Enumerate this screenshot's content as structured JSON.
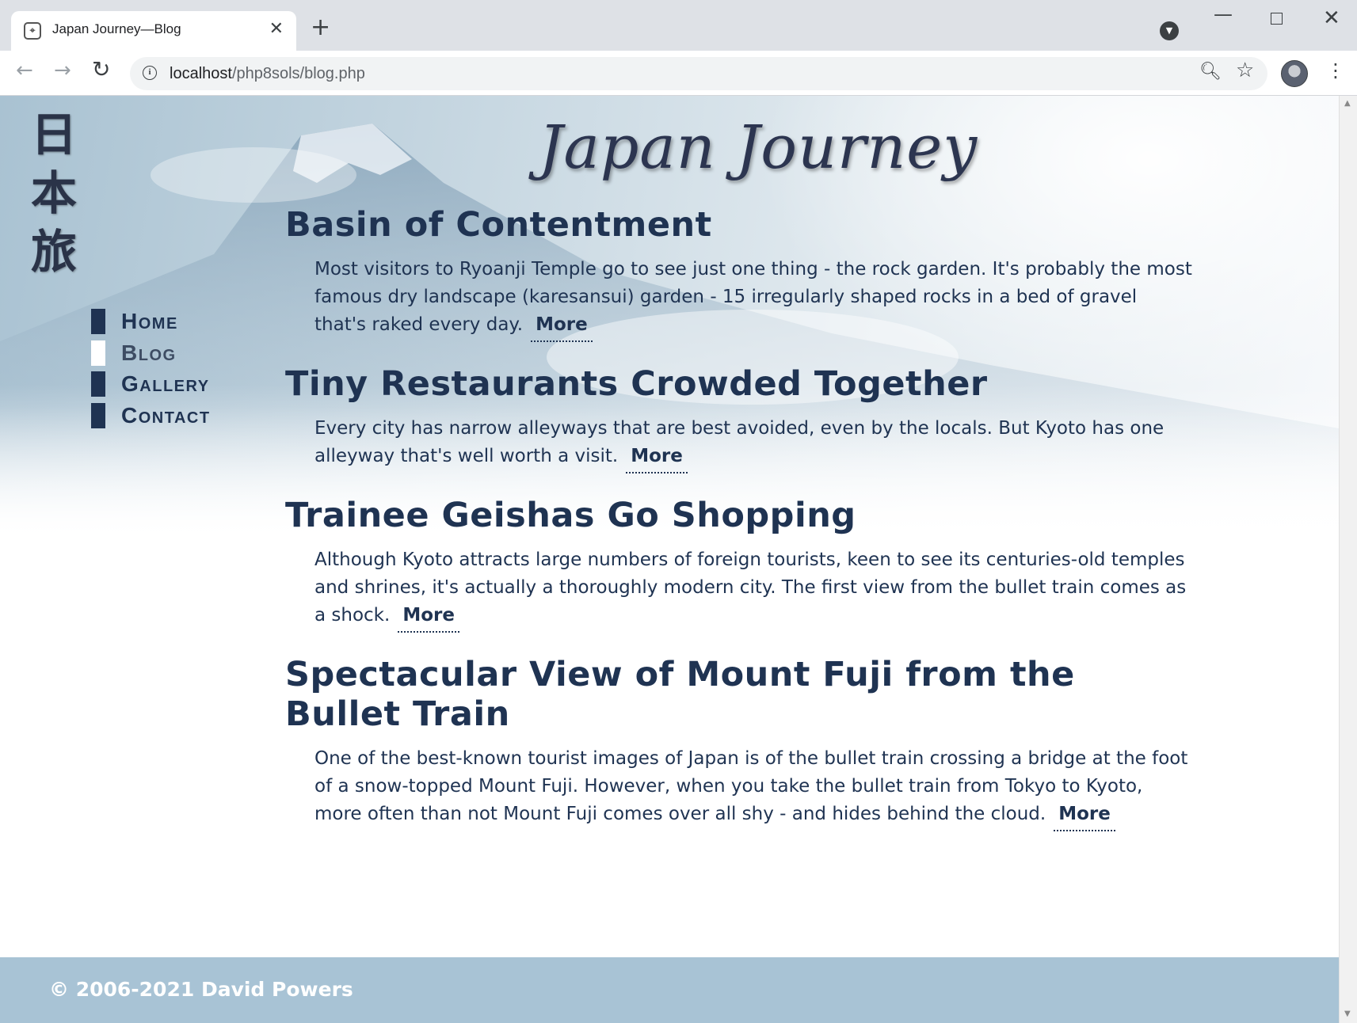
{
  "browser": {
    "tab_title": "Japan Journey—Blog",
    "url_host": "localhost",
    "url_path": "/php8sols/blog.php"
  },
  "site": {
    "title": "Japan Journey",
    "kanji": [
      "日",
      "本",
      "旅"
    ]
  },
  "nav": {
    "items": [
      {
        "label": "Home"
      },
      {
        "label": "Blog"
      },
      {
        "label": "Gallery"
      },
      {
        "label": "Contact"
      }
    ]
  },
  "posts": [
    {
      "title": "Basin of Contentment",
      "body": "Most visitors to Ryoanji Temple go to see just one thing - the rock garden. It's probably the most famous dry landscape (karesansui) garden - 15 irregularly shaped rocks in a bed of gravel that's raked every day.",
      "more": "More"
    },
    {
      "title": "Tiny Restaurants Crowded Together",
      "body": "Every city has narrow alleyways that are best avoided, even by the locals. But Kyoto has one alleyway that's well worth a visit.",
      "more": "More"
    },
    {
      "title": "Trainee Geishas Go Shopping",
      "body": "Although Kyoto attracts large numbers of foreign tourists, keen to see its centuries-old temples and shrines, it's actually a thoroughly modern city. The first view from the bullet train comes as a shock.",
      "more": "More"
    },
    {
      "title": "Spectacular View of Mount Fuji from the Bullet Train",
      "body": "One of the best-known tourist images of Japan is of the bullet train crossing a bridge at the foot of a snow-topped Mount Fuji. However, when you take the bullet train from Tokyo to Kyoto, more often than not Mount Fuji comes over all shy - and hides behind the cloud.",
      "more": "More"
    }
  ],
  "footer": {
    "copyright": "© 2006-2021 David Powers"
  },
  "colors": {
    "primary": "#1f3352",
    "footer_bg": "#a8c3d5"
  }
}
